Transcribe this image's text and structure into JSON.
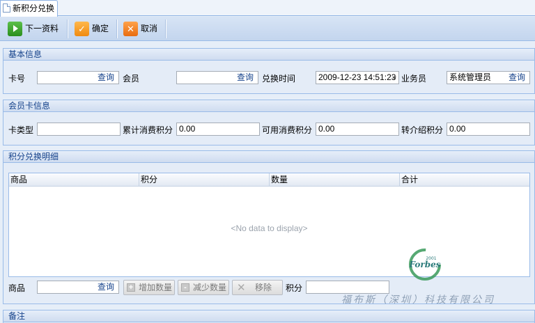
{
  "tab": {
    "title": "新积分兑换"
  },
  "toolbar": {
    "next_label": "下一资料",
    "ok_label": "确定",
    "cancel_label": "取消"
  },
  "basic": {
    "header": "基本信息",
    "card_label": "卡号",
    "card_value": "",
    "member_label": "会员",
    "member_value": "",
    "time_label": "兑换时间",
    "time_value": "2009-12-23 14:51:23",
    "staff_label": "业务员",
    "staff_value": "系统管理员",
    "query_label": "查询"
  },
  "card": {
    "header": "会员卡信息",
    "type_label": "卡类型",
    "type_value": "",
    "total_label": "累计消费积分",
    "total_value": "0.00",
    "avail_label": "可用消费积分",
    "avail_value": "0.00",
    "referral_label": "转介绍积分",
    "referral_value": "0.00"
  },
  "detail": {
    "header": "积分兑换明细",
    "columns": [
      "商品",
      "积分",
      "数量",
      "合计"
    ],
    "empty_text": "<No data to display>",
    "product_label": "商品",
    "product_value": "",
    "query_label": "查询",
    "add_label": "增加数量",
    "reduce_label": "减少数量",
    "remove_label": "移除",
    "points_label": "积分",
    "points_value": ""
  },
  "remark": {
    "header": "备注"
  },
  "watermark": {
    "logo_text": "Forbes",
    "logo_year": "2001",
    "company": "福布斯（深圳）科技有限公司"
  }
}
